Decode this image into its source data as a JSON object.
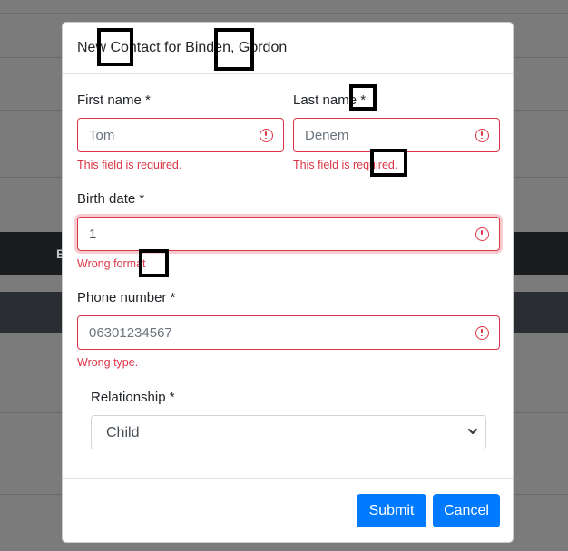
{
  "modal": {
    "title": "New Contact for Binden, Gordon"
  },
  "form": {
    "first_name": {
      "label": "First name *",
      "placeholder": "Tom",
      "error": "This field is required."
    },
    "last_name": {
      "label": "Last name *",
      "placeholder": "Denem",
      "error": "This field is required."
    },
    "birth_date": {
      "label": "Birth date *",
      "value": "1",
      "error": "Wrong format"
    },
    "phone_number": {
      "label": "Phone number *",
      "placeholder": "06301234567",
      "error": "Wrong type."
    },
    "relationship": {
      "label": "Relationship *",
      "selected": "Child"
    }
  },
  "buttons": {
    "submit": "Submit",
    "cancel": "Cancel"
  },
  "background": {
    "dark_row_text": "E"
  },
  "icons": {
    "error": "exclamation-circle-icon",
    "select": "chevron-down-icon"
  },
  "colors": {
    "error": "#dc3545",
    "primary": "#007bff"
  }
}
